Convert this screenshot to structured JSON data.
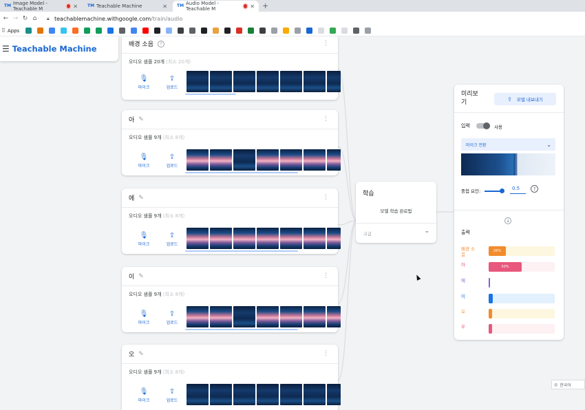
{
  "browser": {
    "tabs": [
      {
        "title": "Image Model - Teachable M",
        "recording": true
      },
      {
        "title": "Teachable Machine",
        "recording": false
      },
      {
        "title": "Audio Model - Teachable M",
        "recording": true
      }
    ],
    "url_host": "teachablemachine.withgoogle.com",
    "url_path": "/train/audio",
    "bookmarks_label": "Apps"
  },
  "app": {
    "title": "Teachable Machine"
  },
  "classes": [
    {
      "name": "배경 소음",
      "samples": "오디오 샘플 20개",
      "samples_min": " (최소 20개)",
      "spec": "dark"
    },
    {
      "name": "아",
      "samples": "오디오 샘플 9개",
      "samples_min": " (최소 8개)",
      "spec": "pink"
    },
    {
      "name": "에",
      "samples": "오디오 샘플 9개",
      "samples_min": " (최소 8개)",
      "spec": "pink"
    },
    {
      "name": "이",
      "samples": "오디오 샘플 9개",
      "samples_min": " (최소 8개)",
      "spec": "pink"
    },
    {
      "name": "오",
      "samples": "오디오 샘플 9개",
      "samples_min": " (최소 8개)",
      "spec": "pink"
    }
  ],
  "class_buttons": {
    "mic": "마이크",
    "upload": "업로드"
  },
  "training": {
    "title": "학습",
    "status": "모델 학습 완료됨",
    "advanced": "고급"
  },
  "preview": {
    "title": "미리보기",
    "export": "모델 내보내기",
    "input_label": "입력",
    "toggle_label": "사용",
    "toggle_on": true,
    "mic_select": "마이크 전환",
    "overlap_label": "중첩 요인:",
    "overlap_value": "0.5",
    "output_label": "출력",
    "outputs": [
      {
        "name": "배경 소음",
        "percent": 26,
        "label": "26%",
        "color": "#f28b2b",
        "track": "#fef7e0"
      },
      {
        "name": "아",
        "percent": 50,
        "label": "50%",
        "color": "#e8577c",
        "track": "#fdf1f4"
      },
      {
        "name": "에",
        "percent": 2,
        "label": "",
        "color": "#8e5cd6",
        "track": "#ffffff"
      },
      {
        "name": "이",
        "percent": 6,
        "label": "",
        "color": "#1a73e8",
        "track": "#e3f0fd"
      },
      {
        "name": "오",
        "percent": 5,
        "label": "",
        "color": "#f28b2b",
        "track": "#fef7e0"
      },
      {
        "name": "우",
        "percent": 5,
        "label": "",
        "color": "#e8577c",
        "track": "#fdf1f4"
      }
    ]
  },
  "footer": {
    "language": "한국어"
  }
}
